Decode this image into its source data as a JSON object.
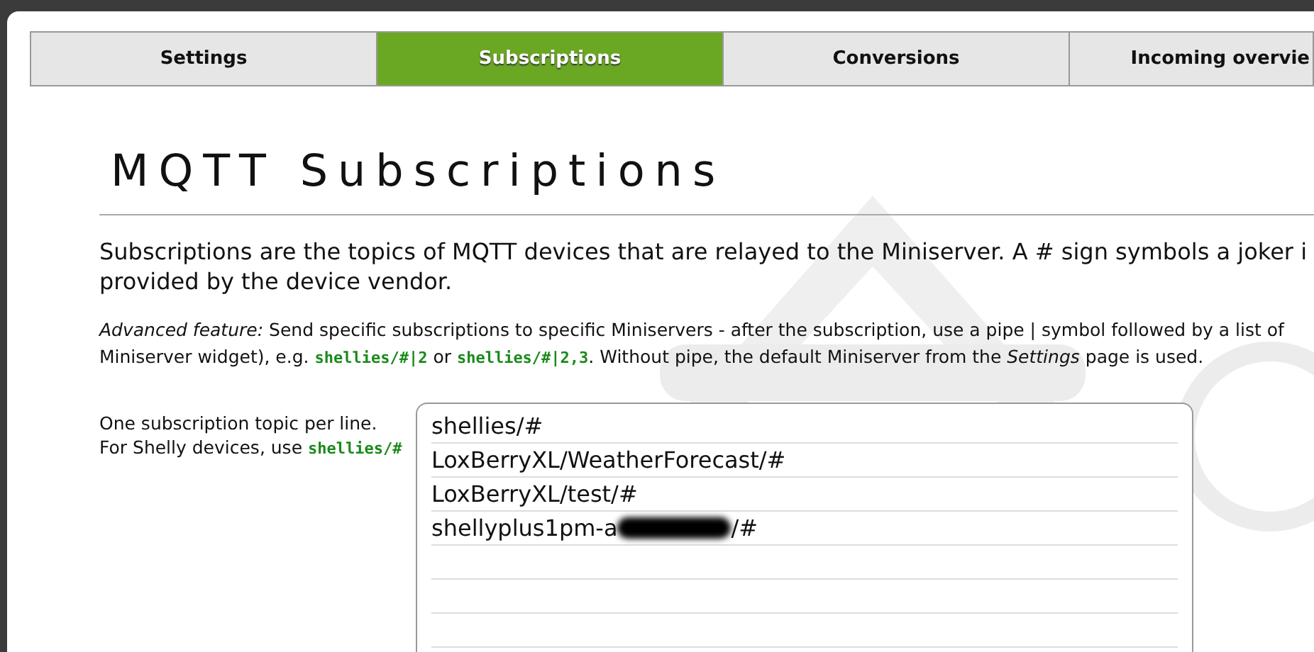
{
  "tabs": [
    {
      "label": "Settings",
      "selected": false
    },
    {
      "label": "Subscriptions",
      "selected": true
    },
    {
      "label": "Conversions",
      "selected": false
    },
    {
      "label": "Incoming overvie",
      "selected": false
    }
  ],
  "title": "MQTT Subscriptions",
  "intro_lines": [
    "Subscriptions are the topics of MQTT devices that are relayed to the Miniserver. A # sign symbols a joker i",
    "provided by the device vendor."
  ],
  "advanced_lines": [
    [
      {
        "kind": "plain",
        "text": "*Advanced feature:* Send specific subscriptions to specific Miniservers - after the subscription, use a pipe | symbol followed by a list of"
      }
    ],
    [
      {
        "kind": "plain",
        "text": "Miniserver widget), e.g. "
      },
      {
        "kind": "code",
        "text": "shellies/#|2"
      },
      {
        "kind": "plain",
        "text": " or "
      },
      {
        "kind": "code",
        "text": "shellies/#|2,3"
      },
      {
        "kind": "plain",
        "text": ". Without pipe, the default Miniserver from the *Settings* page is used."
      }
    ]
  ],
  "field_help_lines": [
    [
      {
        "kind": "plain",
        "text": "One subscription topic per line."
      }
    ],
    [
      {
        "kind": "plain",
        "text": "For Shelly devices, use "
      },
      {
        "kind": "code",
        "text": "shellies/#"
      }
    ]
  ],
  "topics": [
    {
      "text": "shellies/#",
      "redacted": false
    },
    {
      "text": "LoxBerryXL/WeatherForecast/#",
      "redacted": false
    },
    {
      "text": "LoxBerryXL/test/#",
      "redacted": false
    },
    {
      "text": "shellyplus1pm-a",
      "redacted": true,
      "after": "/#"
    }
  ]
}
